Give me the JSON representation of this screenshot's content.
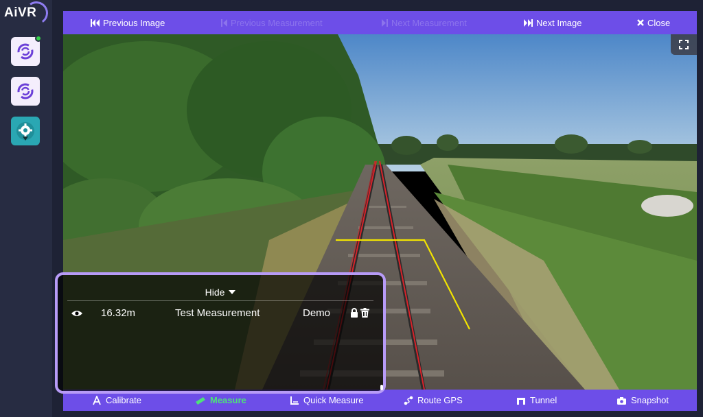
{
  "app": {
    "logo_text": "AiVR"
  },
  "colors": {
    "accent": "#6d4ee8",
    "active": "#4ee07a",
    "overlay_border": "#b79bf7",
    "measure_line": "#f2e400",
    "rail_highlight": "#d8232a"
  },
  "toolbar": {
    "previous_image": "Previous Image",
    "previous_measurement": "Previous Measurement",
    "next_measurement": "Next Measurement",
    "next_image": "Next Image",
    "close": "Close"
  },
  "bottom_toolbar": {
    "calibrate": "Calibrate",
    "measure": "Measure",
    "quick_measure": "Quick Measure",
    "route_gps": "Route GPS",
    "tunnel": "Tunnel",
    "snapshot": "Snapshot"
  },
  "measurements_panel": {
    "toggle_label": "Hide",
    "rows": [
      {
        "value": "16.32m",
        "name": "Test Measurement",
        "author": "Demo"
      }
    ]
  }
}
